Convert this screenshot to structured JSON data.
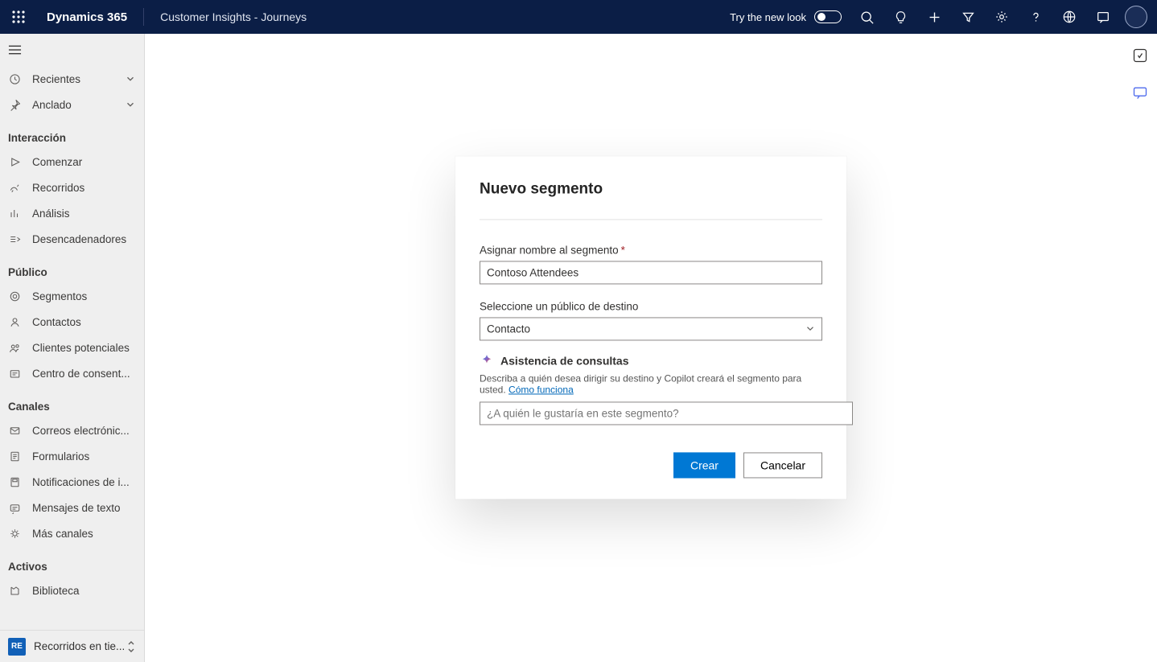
{
  "header": {
    "app": "Dynamics 365",
    "module": "Customer Insights - Journeys",
    "try_label": "Try the new look"
  },
  "sidebar": {
    "recent": "Recientes",
    "pinned": "Anclado",
    "groups": [
      {
        "title": "Interacción",
        "items": [
          "Comenzar",
          "Recorridos",
          "Análisis",
          "Desencadenadores"
        ]
      },
      {
        "title": "Público",
        "items": [
          "Segmentos",
          "Contactos",
          "Clientes potenciales",
          "Centro de consent..."
        ]
      },
      {
        "title": "Canales",
        "items": [
          "Correos electrónic...",
          "Formularios",
          "Notificaciones de i...",
          "Mensajes de texto",
          "Más canales"
        ]
      },
      {
        "title": "Activos",
        "items": [
          "Biblioteca"
        ]
      }
    ],
    "footer_badge": "RE",
    "footer_label": "Recorridos en tie..."
  },
  "dialog": {
    "title": "Nuevo segmento",
    "name_label": "Asignar nombre al segmento",
    "name_value": "Contoso Attendees",
    "audience_label": "Seleccione un público de destino",
    "audience_value": "Contacto",
    "qa_title": "Asistencia de consultas",
    "qa_desc": "Describa a quién desea dirigir su destino y Copilot creará el segmento para usted. ",
    "qa_link": "Cómo funciona",
    "qa_placeholder": "¿A quién le gustaría en este segmento?",
    "create": "Crear",
    "cancel": "Cancelar"
  }
}
